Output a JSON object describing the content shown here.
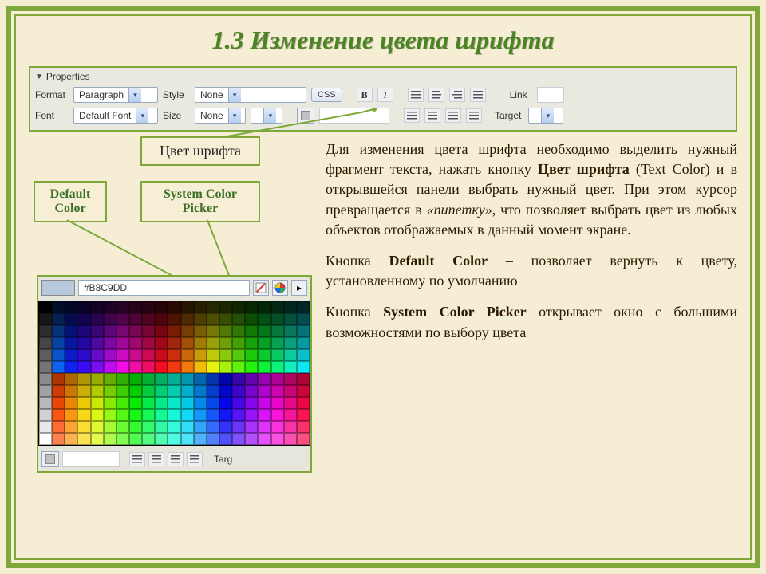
{
  "title": "1.3  Изменение цвета шрифта",
  "props": {
    "header": "Properties",
    "format_lbl": "Format",
    "format_val": "Paragraph",
    "style_lbl": "Style",
    "style_val": "None",
    "css": "CSS",
    "link_lbl": "Link",
    "font_lbl": "Font",
    "font_val": "Default Font",
    "size_lbl": "Size",
    "size_val": "None",
    "target_lbl": "Target",
    "targ": "Targ"
  },
  "callouts": {
    "text_color": "Цвет шрифта",
    "default_color": "Default Color",
    "system_picker": "System Color Picker"
  },
  "picker": {
    "hex": "#B8C9DD"
  },
  "body": {
    "p1a": "Для изменения цвета шрифта необходимо выделить нужный фрагмент текста, нажать кнопку ",
    "p1b": "Цвет шрифта",
    "p1c": " (Text Color) и в открывшейся панели выбрать нужный цвет. При этом курсор превращается в ",
    "p1d": "«пипетку»",
    "p1e": ", что позволяет выбрать цвет из любых объектов отображаемых в данный момент экране.",
    "p2a": "Кнопка ",
    "p2b": "Default Color",
    "p2c": " – позволяет вернуть к цвету, установленному по умолчанию",
    "p3a": "Кнопка ",
    "p3b": "System Color Picker",
    "p3c": " открывает окно с большими возможностями по выбору цвета"
  }
}
